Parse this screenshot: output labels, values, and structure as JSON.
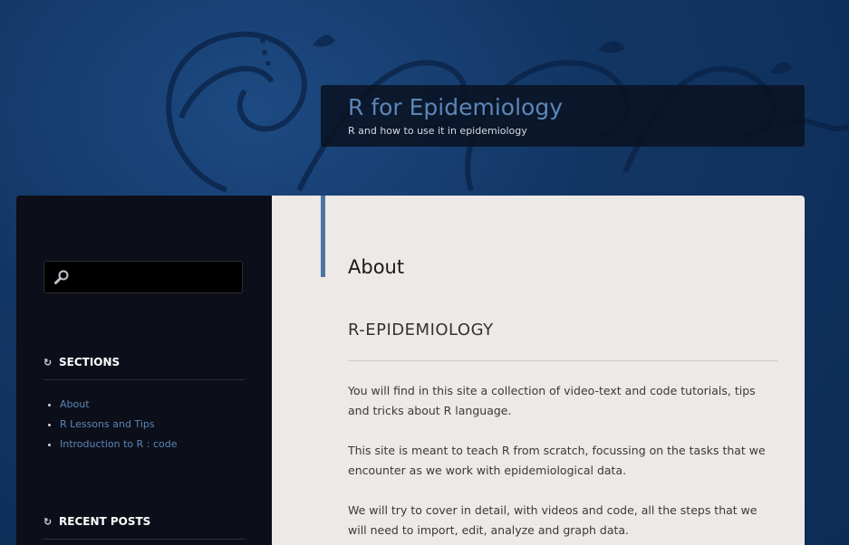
{
  "header": {
    "site_title": "R for Epidemiology",
    "site_description": "R and how to use it in epidemiology"
  },
  "sidebar": {
    "search": {
      "placeholder": "",
      "value": ""
    },
    "sections_title": "SECTIONS",
    "sections": [
      {
        "label": "About"
      },
      {
        "label": "R Lessons and Tips"
      },
      {
        "label": "Introduction to R : code"
      }
    ],
    "recent_posts_title": "RECENT POSTS"
  },
  "main": {
    "page_title": "About",
    "heading": "R-EPIDEMIOLOGY",
    "paragraphs": [
      "You will find in this site a collection of video-text and code tutorials, tips and tricks about R language.",
      "This site is meant to teach R from scratch, focussing on the tasks that we encounter as we work with epidemiological data.",
      "We will try to cover in detail, with videos and code, all the steps that we will need to import, edit, analyze and graph data."
    ]
  },
  "colors": {
    "background": "#123664",
    "accent": "#4a74a3",
    "link": "#5b86b8",
    "sidebar_bg": "#0c0f19",
    "content_bg": "#ede9e6"
  }
}
